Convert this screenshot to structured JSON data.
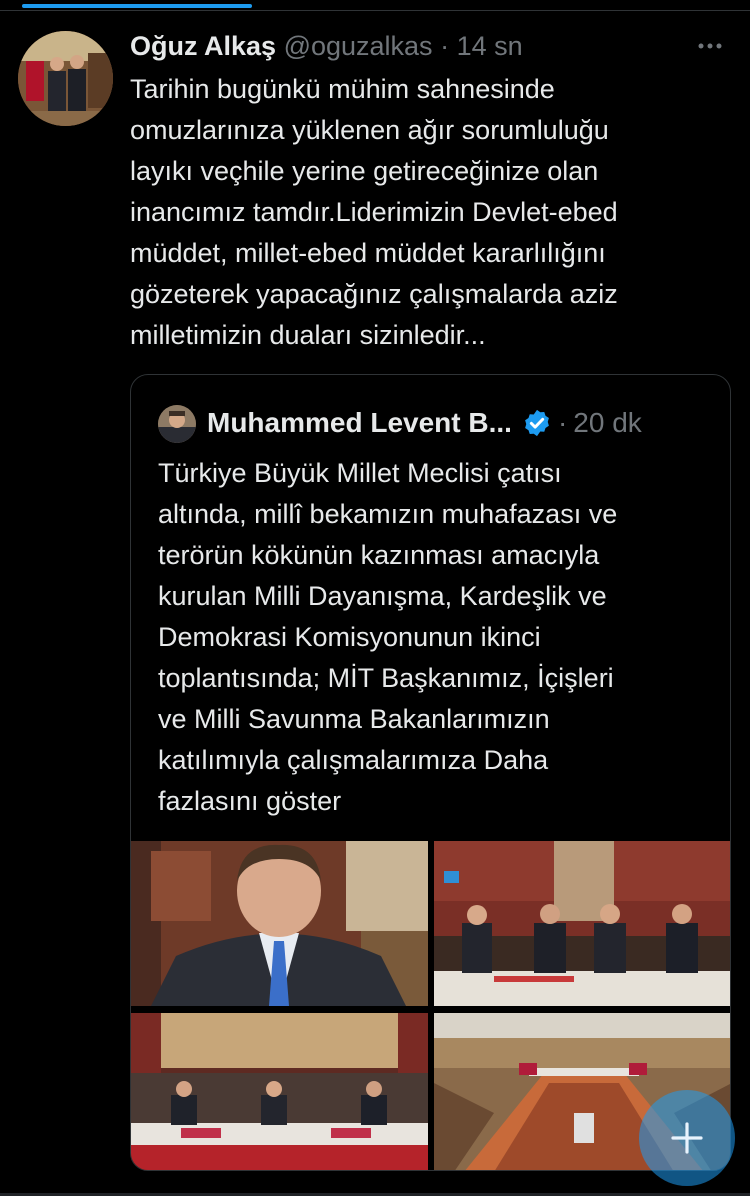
{
  "tweet": {
    "author_name": "Oğuz Alkaş",
    "author_handle": "@oguzalkas",
    "separator": "·",
    "time": "14 sn",
    "text_lines": [
      "Tarihin bugünkü mühim sahnesinde",
      "omuzlarınıza  yüklenen ağır sorumluluğu",
      "layıkı veçhile yerine getireceğinize olan",
      "inancımız tamdır.Liderimizin Devlet-ebed",
      "müddet, millet-ebed müddet kararlılığını",
      "gözeterek yapacağınız çalışmalarda aziz",
      "milletimizin duaları sizinledir..."
    ]
  },
  "quote": {
    "author_name": "Muhammed Levent B...",
    "separator": "·",
    "time": "20 dk",
    "text_lines": [
      "Türkiye Büyük Millet Meclisi çatısı",
      "altında, millî bekamızın muhafazası ve",
      "terörün kökünün kazınması amacıyla",
      "kurulan Milli Dayanışma, Kardeşlik ve",
      "Demokrasi Komisyonunun ikinci",
      "toplantısında; MİT Başkanımız, İçişleri",
      "ve Milli Savunma Bakanlarımızın",
      "katılımıyla çalışmalarımıza Daha"
    ],
    "last_line": "fazlasını göster"
  },
  "icons": {
    "more": "more-horizontal-icon",
    "verified": "verified-badge-icon",
    "compose": "plus-icon"
  },
  "colors": {
    "background": "#000000",
    "text": "#e7e9ea",
    "secondary": "#71767b",
    "accent": "#1d9bf0",
    "border": "#2f3336"
  }
}
